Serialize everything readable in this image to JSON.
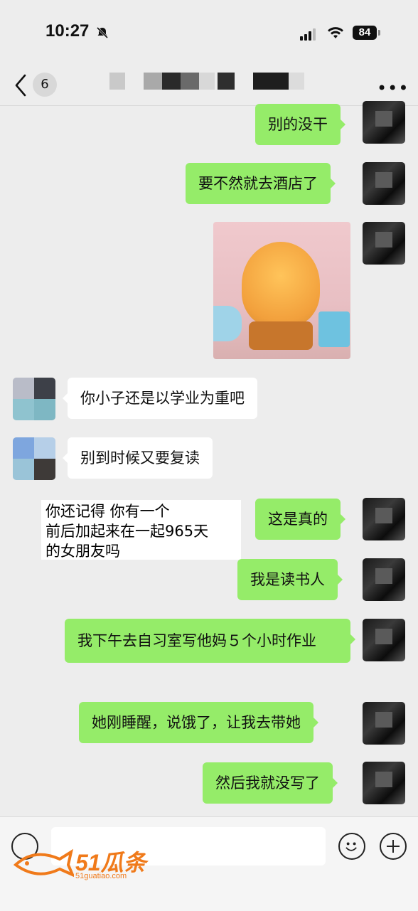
{
  "status_bar": {
    "time": "10:27",
    "battery": "84"
  },
  "nav": {
    "unread_count": "6"
  },
  "messages": [
    {
      "side": "right",
      "text": "别的没干"
    },
    {
      "side": "right",
      "text": "要不然就去酒店了"
    },
    {
      "side": "right",
      "type": "sticker"
    },
    {
      "side": "left",
      "text": "你小子还是以学业为重吧"
    },
    {
      "side": "left",
      "text": "别到时候又要复读"
    },
    {
      "side": "right",
      "text": "这是真的"
    },
    {
      "side": "right",
      "text": "我是读书人"
    },
    {
      "side": "right",
      "text": "我下午去自习室写他妈５个小时作业"
    },
    {
      "side": "right",
      "text": "她刚睡醒，说饿了，让我去带她"
    },
    {
      "side": "right",
      "text": "然后我就没写了"
    }
  ],
  "caption": {
    "line1": "你还记得 你有一个",
    "line2": "前后加起来在一起965天",
    "line3": "的女朋友吗"
  },
  "watermark": {
    "brand": "51瓜条",
    "url": "51guatiao.com"
  },
  "colors": {
    "bubble_self": "#95ec69",
    "bubble_other": "#ffffff",
    "background": "#ededed"
  }
}
